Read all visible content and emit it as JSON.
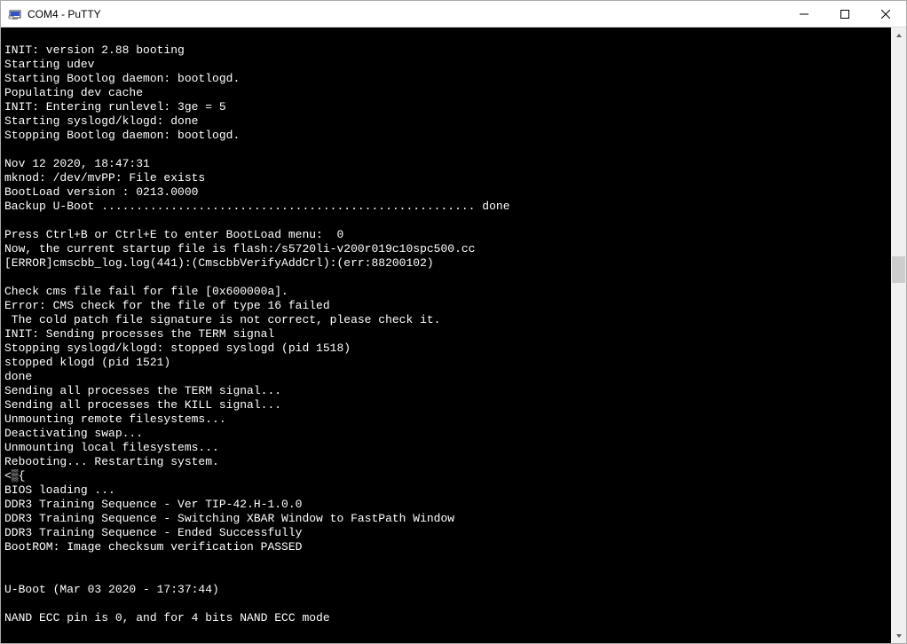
{
  "window": {
    "title": "COM4 - PuTTY"
  },
  "terminal": {
    "lines": [
      "",
      "INIT: version 2.88 booting",
      "Starting udev",
      "Starting Bootlog daemon: bootlogd.",
      "Populating dev cache",
      "INIT: Entering runlevel: 3ge = 5",
      "Starting syslogd/klogd: done",
      "Stopping Bootlog daemon: bootlogd.",
      "",
      "Nov 12 2020, 18:47:31",
      "mknod: /dev/mvPP: File exists",
      "BootLoad version : 0213.0000",
      "Backup U-Boot ...................................................... done",
      "",
      "Press Ctrl+B or Ctrl+E to enter BootLoad menu:  0",
      "Now, the current startup file is flash:/s5720li-v200r019c10spc500.cc",
      "[ERROR]cmscbb_log.log(441):(CmscbbVerifyAddCrl):(err:88200102)",
      "",
      "Check cms file fail for file [0x600000a].",
      "Error: CMS check for the file of type 16 failed",
      " The cold patch file signature is not correct, please check it.",
      "INIT: Sending processes the TERM signal",
      "Stopping syslogd/klogd: stopped syslogd (pid 1518)",
      "stopped klogd (pid 1521)",
      "done",
      "Sending all processes the TERM signal...",
      "Sending all processes the KILL signal...",
      "Unmounting remote filesystems...",
      "Deactivating swap...",
      "Unmounting local filesystems...",
      "Rebooting... Restarting system.",
      "<▒{",
      "BIOS loading ...",
      "DDR3 Training Sequence - Ver TIP-42.H-1.0.0",
      "DDR3 Training Sequence - Switching XBAR Window to FastPath Window",
      "DDR3 Training Sequence - Ended Successfully",
      "BootROM: Image checksum verification PASSED",
      "",
      "",
      "U-Boot (Mar 03 2020 - 17:37:44)",
      "",
      "NAND ECC pin is 0, and for 4 bits NAND ECC mode"
    ]
  }
}
